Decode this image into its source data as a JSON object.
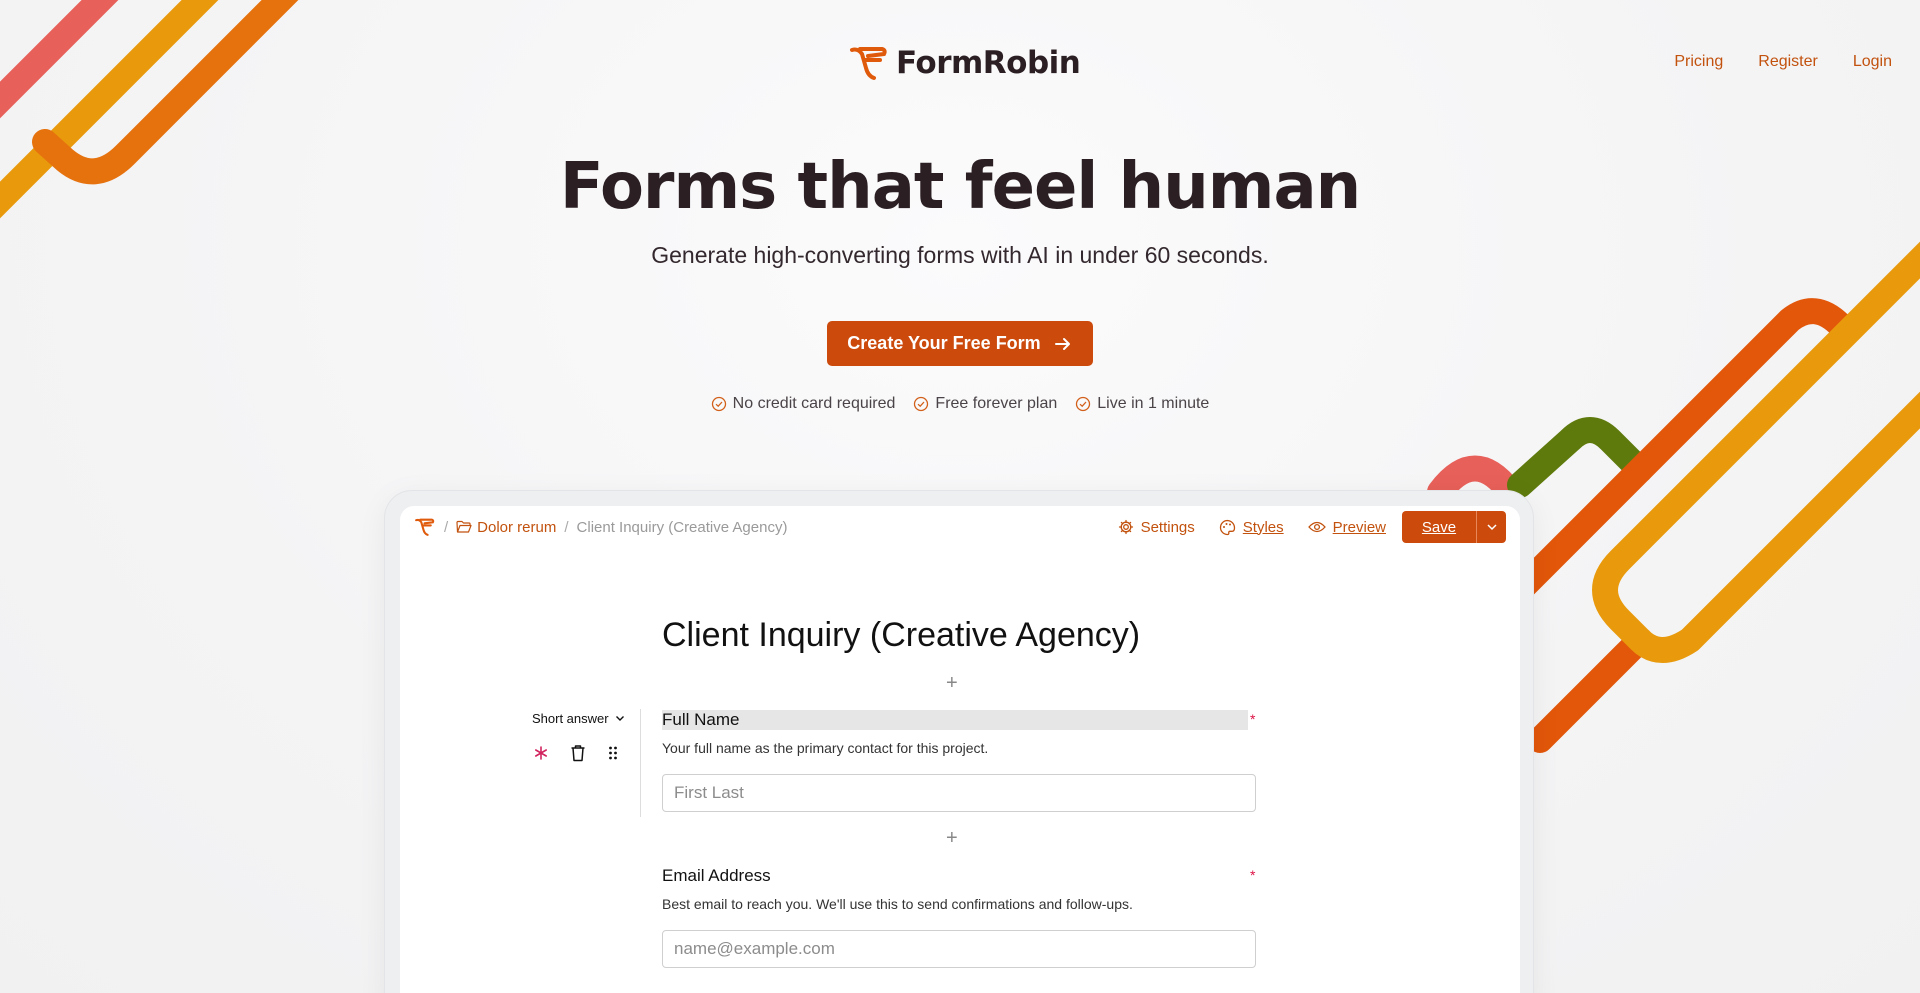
{
  "brand": {
    "name": "FormRobin",
    "accent": "#cb4a0c"
  },
  "nav": {
    "items": [
      "Pricing",
      "Register",
      "Login"
    ]
  },
  "hero": {
    "title": "Forms that feel human",
    "subtitle": "Generate high-converting forms with AI in under 60 seconds.",
    "cta_label": "Create Your Free Form",
    "perks": [
      "No credit card required",
      "Free forever plan",
      "Live in 1 minute"
    ]
  },
  "app": {
    "breadcrumb": {
      "folder": "Dolor rerum",
      "current": "Client Inquiry (Creative Agency)"
    },
    "actions": {
      "settings": "Settings",
      "styles": "Styles",
      "preview": "Preview",
      "save": "Save"
    },
    "form_title": "Client Inquiry (Creative Agency)",
    "field_type": "Short answer",
    "questions": [
      {
        "label": "Full Name",
        "description": "Your full name as the primary contact for this project.",
        "placeholder": "First Last",
        "required_mark": "*"
      },
      {
        "label": "Email Address",
        "description": "Best email to reach you. We'll use this to send confirmations and follow-ups.",
        "placeholder": "name@example.com",
        "required_mark": "*"
      }
    ]
  }
}
